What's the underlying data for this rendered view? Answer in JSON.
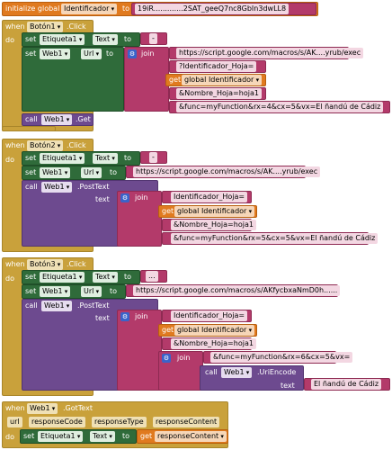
{
  "init": {
    "label": "initialize global",
    "name": "Identificador",
    "to": "to",
    "value": "19iR.............2SAT_geeQ7nc8GbIn3dwLL8"
  },
  "common": {
    "when": "when",
    "do": "do",
    "set": "set",
    "to": "to",
    "call": "call",
    "text": "text",
    "join": "join",
    "etiqueta": "Etiqueta1",
    "text_prop": "Text",
    "web": "Web1",
    "url_prop": "Url",
    "dash": "-",
    "dots": "...",
    "get": "get",
    "global_id": "global Identificador"
  },
  "b1": {
    "event": "Botón1",
    "click": ".Click",
    "url": "https://script.google.com/macros/s/AK....yrub/exec",
    "p1": "?Identificador_Hoja=",
    "p2": "&Nombre_Hoja=hoja1",
    "p3": "&func=myFunction&rx=4&cx=5&vx=El ñandú de Cádiz",
    "get": ".Get"
  },
  "b2": {
    "event": "Botón2",
    "click": ".Click",
    "url": "https://script.google.com/macros/s/AK....yrub/exec",
    "post": ".PostText",
    "p1": "Identificador_Hoja=",
    "p2": "&Nombre_Hoja=hoja1",
    "p3": "&func=myFunction&rx=5&cx=5&vx=El ñandú de Cádiz"
  },
  "b3": {
    "event": "Botón3",
    "click": ".Click",
    "url": "https://script.google.com/macros/s/AKfycbxaNmD0h......",
    "post": ".PostText",
    "p1": "Identificador_Hoja=",
    "p2": "&Nombre_Hoja=hoja1",
    "p3": "&func=myFunction&rx=6&cx=5&vx=",
    "encode": ".UriEncode",
    "val": "El ñandú de Cádiz"
  },
  "got": {
    "event": "Web1",
    "name": ".GotText",
    "params": [
      "url",
      "responseCode",
      "responseType",
      "responseContent"
    ],
    "get": "get",
    "resp": "responseContent"
  },
  "icons": {
    "mutator": "gear-icon"
  }
}
